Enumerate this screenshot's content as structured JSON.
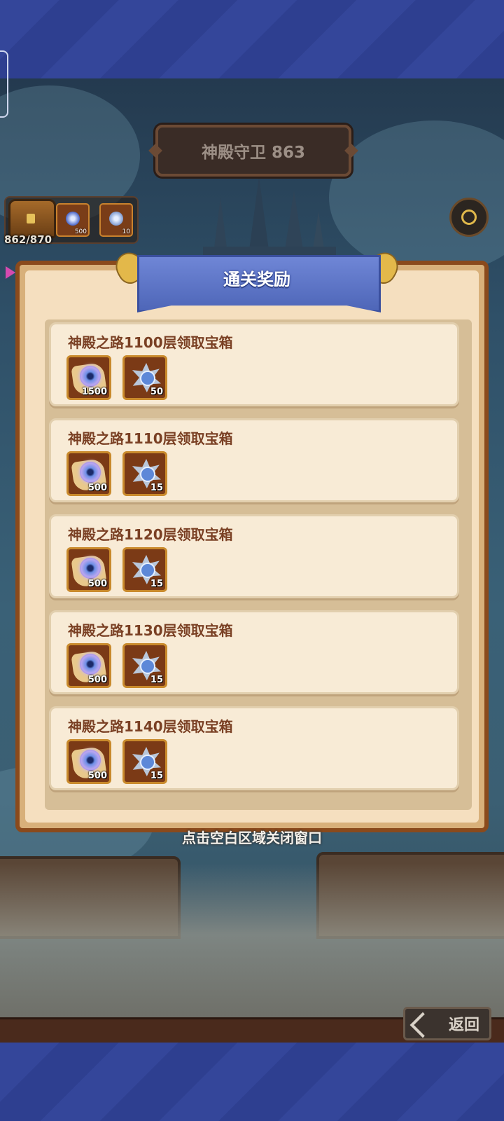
{
  "header": {
    "level_title": "神殿守卫 863"
  },
  "chest_panel": {
    "progress": "862/870",
    "items": [
      {
        "icon": "eye-scroll-icon",
        "qty": "500"
      },
      {
        "icon": "star-ore-icon",
        "qty": "10"
      }
    ]
  },
  "dialog": {
    "title": "通关奖励",
    "rewards": [
      {
        "title": "神殿之路1100层领取宝箱",
        "items": [
          {
            "icon": "eye-scroll-icon",
            "qty": "1500"
          },
          {
            "icon": "star-ore-icon",
            "qty": "50"
          }
        ]
      },
      {
        "title": "神殿之路1110层领取宝箱",
        "items": [
          {
            "icon": "eye-scroll-icon",
            "qty": "500"
          },
          {
            "icon": "star-ore-icon",
            "qty": "15"
          }
        ]
      },
      {
        "title": "神殿之路1120层领取宝箱",
        "items": [
          {
            "icon": "eye-scroll-icon",
            "qty": "500"
          },
          {
            "icon": "star-ore-icon",
            "qty": "15"
          }
        ]
      },
      {
        "title": "神殿之路1130层领取宝箱",
        "items": [
          {
            "icon": "eye-scroll-icon",
            "qty": "500"
          },
          {
            "icon": "star-ore-icon",
            "qty": "15"
          }
        ]
      },
      {
        "title": "神殿之路1140层领取宝箱",
        "items": [
          {
            "icon": "eye-scroll-icon",
            "qty": "500"
          },
          {
            "icon": "star-ore-icon",
            "qty": "15"
          }
        ]
      }
    ]
  },
  "hint": "点击空白区域关闭窗口",
  "back_button": {
    "label": "返回"
  },
  "colors": {
    "dialog_bg": "#f5dfbf",
    "ribbon": "#5a72c8",
    "frame": "#8a4a1c",
    "item_bg": "#7b3a16"
  }
}
